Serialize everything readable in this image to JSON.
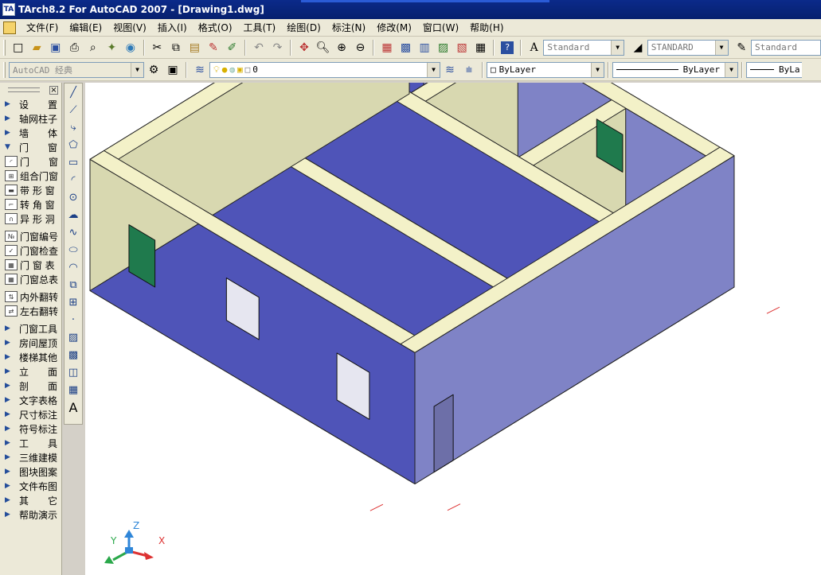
{
  "window": {
    "title": "TArch8.2 For AutoCAD 2007 - [Drawing1.dwg]"
  },
  "menu": {
    "items": [
      "文件(F)",
      "编辑(E)",
      "视图(V)",
      "插入(I)",
      "格式(O)",
      "工具(T)",
      "绘图(D)",
      "标注(N)",
      "修改(M)",
      "窗口(W)",
      "帮助(H)"
    ]
  },
  "toolbar1": {
    "text_style": "Standard",
    "dim_style": "STANDARD",
    "table_style": "Standard"
  },
  "toolbar2": {
    "workspace": "AutoCAD 经典",
    "layer": "0",
    "color": "ByLayer",
    "linetype": "ByLayer",
    "lineweight": "ByLa"
  },
  "leftpanel": {
    "items": [
      {
        "label": "设　　置",
        "kind": "collapsed"
      },
      {
        "label": "轴网柱子",
        "kind": "collapsed"
      },
      {
        "label": "墙　　体",
        "kind": "collapsed"
      },
      {
        "label": "门　　窗",
        "kind": "expanded"
      },
      {
        "label": "门　　窗",
        "kind": "tool",
        "icon": "door-icon"
      },
      {
        "label": "组合门窗",
        "kind": "tool",
        "icon": "combo-window-icon"
      },
      {
        "label": "带 形 窗",
        "kind": "tool",
        "icon": "strip-window-icon"
      },
      {
        "label": "转 角 窗",
        "kind": "tool",
        "icon": "corner-window-icon"
      },
      {
        "label": "异 形 洞",
        "kind": "tool",
        "icon": "arch-hole-icon"
      },
      {
        "label": "门窗编号",
        "kind": "tool",
        "icon": "window-number-icon"
      },
      {
        "label": "门窗检查",
        "kind": "tool",
        "icon": "window-check-icon"
      },
      {
        "label": "门 窗 表",
        "kind": "tool",
        "icon": "window-table-icon"
      },
      {
        "label": "门窗总表",
        "kind": "tool",
        "icon": "window-summary-icon"
      },
      {
        "label": "内外翻转",
        "kind": "tool",
        "icon": "flip-inout-icon"
      },
      {
        "label": "左右翻转",
        "kind": "tool",
        "icon": "flip-lr-icon"
      },
      {
        "label": "门窗工具",
        "kind": "collapsed"
      },
      {
        "label": "房间屋顶",
        "kind": "collapsed"
      },
      {
        "label": "楼梯其他",
        "kind": "collapsed"
      },
      {
        "label": "立　　面",
        "kind": "collapsed"
      },
      {
        "label": "剖　　面",
        "kind": "collapsed"
      },
      {
        "label": "文字表格",
        "kind": "collapsed"
      },
      {
        "label": "尺寸标注",
        "kind": "collapsed"
      },
      {
        "label": "符号标注",
        "kind": "collapsed"
      },
      {
        "label": "工　　具",
        "kind": "collapsed"
      },
      {
        "label": "三维建模",
        "kind": "collapsed"
      },
      {
        "label": "图块图案",
        "kind": "collapsed"
      },
      {
        "label": "文件布图",
        "kind": "collapsed"
      },
      {
        "label": "其　　它",
        "kind": "collapsed"
      },
      {
        "label": "帮助演示",
        "kind": "collapsed"
      }
    ]
  },
  "ucs": {
    "x_label": "X",
    "y_label": "Y",
    "z_label": "Z"
  },
  "colors": {
    "wall_blue": "#4f54b8",
    "wall_light_blue": "#7f83c6",
    "wall_cream": "#d8d8b0",
    "wall_top": "#f3f1c8",
    "floor": "#e4e4e4",
    "window_green": "#1f7a4d"
  }
}
